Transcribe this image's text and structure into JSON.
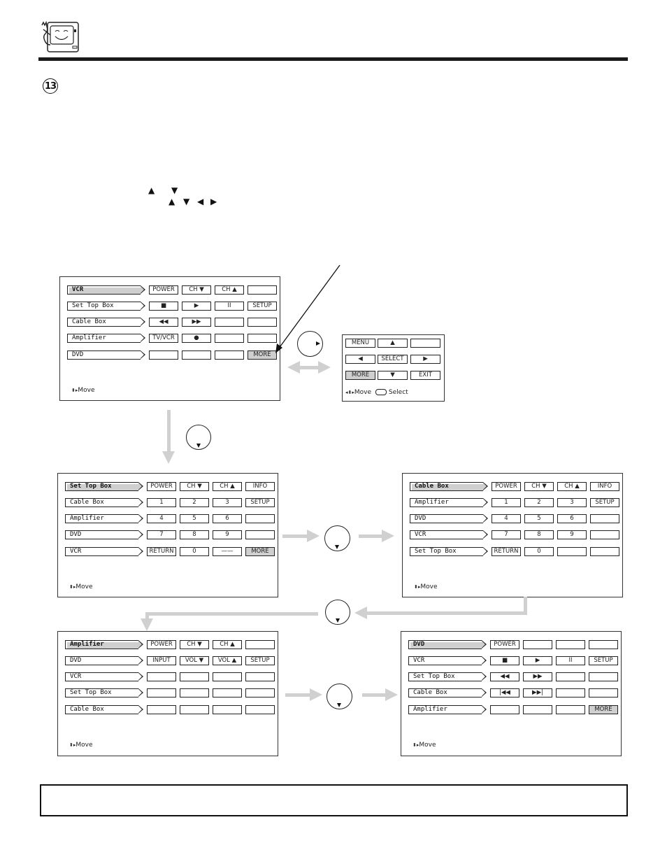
{
  "page": {
    "step_number": "13",
    "inline_arrows_line1": [
      "▲",
      "▼"
    ],
    "inline_arrows_line2": [
      "▲",
      "▼",
      "◀",
      "▶"
    ]
  },
  "screens": {
    "vcr": {
      "devices": [
        "VCR",
        "Set Top Box",
        "Cable Box",
        "Amplifier",
        "DVD"
      ],
      "selected_index": 0,
      "buttons": [
        [
          "POWER",
          "CH ▼",
          "CH ▲",
          ""
        ],
        [
          "■",
          "▶",
          "II",
          "SETUP"
        ],
        [
          "◀◀",
          "▶▶",
          "",
          ""
        ],
        [
          "TV/VCR",
          "●",
          "",
          ""
        ],
        [
          "",
          "",
          "",
          "MORE"
        ]
      ],
      "move_label": "Move"
    },
    "more_popup": {
      "buttons": [
        [
          "MENU",
          "▲",
          ""
        ],
        [
          "◀",
          "SELECT",
          "▶"
        ],
        [
          "MORE",
          "▼",
          "EXIT"
        ]
      ],
      "move_label": "Move",
      "select_label": "Select"
    },
    "set_top_box": {
      "devices": [
        "Set Top Box",
        "Cable Box",
        "Amplifier",
        "DVD",
        "VCR"
      ],
      "selected_index": 0,
      "buttons": [
        [
          "POWER",
          "CH ▼",
          "CH ▲",
          "INFO"
        ],
        [
          "1",
          "2",
          "3",
          "SETUP"
        ],
        [
          "4",
          "5",
          "6",
          ""
        ],
        [
          "7",
          "8",
          "9",
          ""
        ],
        [
          "RETURN",
          "0",
          "——",
          "MORE"
        ]
      ],
      "move_label": "Move"
    },
    "cable_box": {
      "devices": [
        "Cable Box",
        "Amplifier",
        "DVD",
        "VCR",
        "Set Top Box"
      ],
      "selected_index": 0,
      "buttons": [
        [
          "POWER",
          "CH ▼",
          "CH ▲",
          "INFO"
        ],
        [
          "1",
          "2",
          "3",
          "SETUP"
        ],
        [
          "4",
          "5",
          "6",
          ""
        ],
        [
          "7",
          "8",
          "9",
          ""
        ],
        [
          "RETURN",
          "0",
          "",
          ""
        ]
      ],
      "move_label": "Move"
    },
    "amplifier": {
      "devices": [
        "Amplifier",
        "DVD",
        "VCR",
        "Set Top Box",
        "Cable Box"
      ],
      "selected_index": 0,
      "buttons": [
        [
          "POWER",
          "CH ▼",
          "CH ▲",
          ""
        ],
        [
          "INPUT",
          "VOL ▼",
          "VOL ▲",
          "SETUP"
        ],
        [
          "",
          "",
          "",
          ""
        ],
        [
          "",
          "",
          "",
          ""
        ],
        [
          "",
          "",
          "",
          ""
        ]
      ],
      "move_label": "Move"
    },
    "dvd": {
      "devices": [
        "DVD",
        "VCR",
        "Set Top Box",
        "Cable Box",
        "Amplifier"
      ],
      "selected_index": 0,
      "buttons": [
        [
          "POWER",
          "",
          "",
          ""
        ],
        [
          "■",
          "▶",
          "II",
          "SETUP"
        ],
        [
          "◀◀",
          "▶▶",
          "",
          ""
        ],
        [
          "|◀◀",
          "▶▶|",
          "",
          ""
        ],
        [
          "",
          "",
          "",
          "MORE"
        ]
      ],
      "move_label": "Move"
    }
  },
  "colors": {
    "highlight": "#cfcfcf",
    "flow_arrow": "#d0d0d0",
    "rule": "#1a1a1a"
  }
}
